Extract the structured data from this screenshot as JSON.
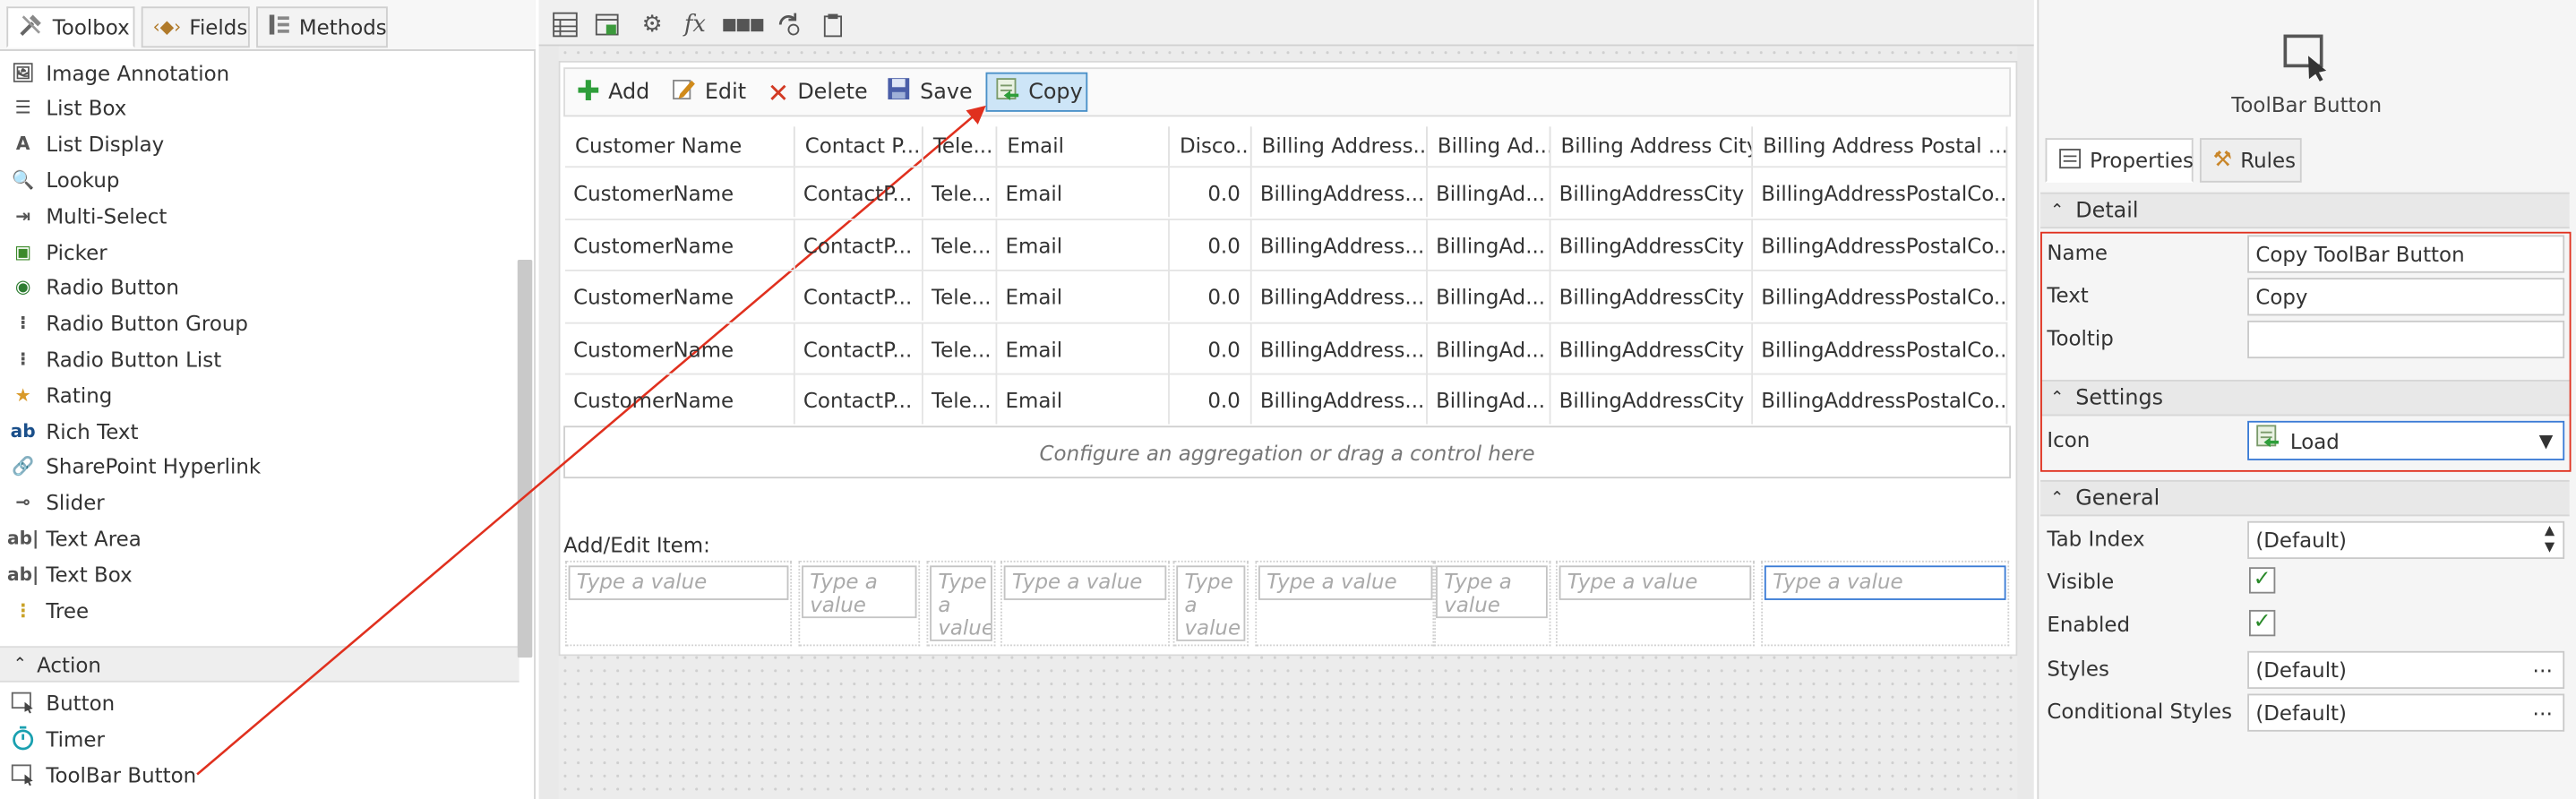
{
  "toolbox": {
    "tabs": [
      {
        "label": "Toolbox"
      },
      {
        "label": "Fields"
      },
      {
        "label": "Methods"
      }
    ],
    "items": [
      {
        "label": "Image Annotation",
        "icon": "image-annotation-icon"
      },
      {
        "label": "List Box",
        "icon": "list-box-icon"
      },
      {
        "label": "List Display",
        "icon": "list-display-icon"
      },
      {
        "label": "Lookup",
        "icon": "lookup-icon"
      },
      {
        "label": "Multi-Select",
        "icon": "multi-select-icon"
      },
      {
        "label": "Picker",
        "icon": "picker-icon"
      },
      {
        "label": "Radio Button",
        "icon": "radio-button-icon"
      },
      {
        "label": "Radio Button Group",
        "icon": "radio-button-group-icon"
      },
      {
        "label": "Radio Button List",
        "icon": "radio-button-list-icon"
      },
      {
        "label": "Rating",
        "icon": "rating-icon"
      },
      {
        "label": "Rich Text",
        "icon": "rich-text-icon"
      },
      {
        "label": "SharePoint Hyperlink",
        "icon": "hyperlink-icon"
      },
      {
        "label": "Slider",
        "icon": "slider-icon"
      },
      {
        "label": "Text Area",
        "icon": "text-area-icon"
      },
      {
        "label": "Text Box",
        "icon": "text-box-icon"
      },
      {
        "label": "Tree",
        "icon": "tree-icon"
      }
    ],
    "action_section": "Action",
    "action_items": [
      {
        "label": "Button",
        "icon": "button-icon"
      },
      {
        "label": "Timer",
        "icon": "timer-icon"
      },
      {
        "label": "ToolBar Button",
        "icon": "toolbar-button-icon"
      }
    ]
  },
  "designer": {
    "toolbar_buttons": [
      {
        "label": "Add",
        "icon": "plus-icon",
        "color": "#2e9e3a"
      },
      {
        "label": "Edit",
        "icon": "edit-icon",
        "color": "#d08a1a"
      },
      {
        "label": "Delete",
        "icon": "delete-icon",
        "color": "#d23a24"
      },
      {
        "label": "Save",
        "icon": "save-icon",
        "color": "#4a5ea8"
      },
      {
        "label": "Copy",
        "icon": "copy-icon",
        "color": "#3a8ad0"
      }
    ],
    "columns": [
      "Customer Name",
      "Contact P...",
      "Tele...",
      "Email",
      "Disco...",
      "Billing Address...",
      "Billing Ad...",
      "Billing Address City",
      "Billing Address Postal ..."
    ],
    "rows": [
      [
        "CustomerName",
        "ContactP...",
        "Tele...",
        "Email",
        "0.0",
        "BillingAddress...",
        "BillingAd...",
        "BillingAddressCity",
        "BillingAddressPostalCo..."
      ],
      [
        "CustomerName",
        "ContactP...",
        "Tele...",
        "Email",
        "0.0",
        "BillingAddress...",
        "BillingAd...",
        "BillingAddressCity",
        "BillingAddressPostalCo..."
      ],
      [
        "CustomerName",
        "ContactP...",
        "Tele...",
        "Email",
        "0.0",
        "BillingAddress...",
        "BillingAd...",
        "BillingAddressCity",
        "BillingAddressPostalCo..."
      ],
      [
        "CustomerName",
        "ContactP...",
        "Tele...",
        "Email",
        "0.0",
        "BillingAddress...",
        "BillingAd...",
        "BillingAddressCity",
        "BillingAddressPostalCo..."
      ],
      [
        "CustomerName",
        "ContactP...",
        "Tele...",
        "Email",
        "0.0",
        "BillingAddress...",
        "BillingAd...",
        "BillingAddressCity",
        "BillingAddressPostalCo..."
      ]
    ],
    "aggregation_hint": "Configure an aggregation or drag a control here",
    "add_edit_label": "Add/Edit Item:",
    "input_placeholder": "Type a value"
  },
  "properties": {
    "control_title": "ToolBar Button",
    "tabs": [
      {
        "label": "Properties"
      },
      {
        "label": "Rules"
      }
    ],
    "detail_section": "Detail",
    "name_label": "Name",
    "name_value": "Copy ToolBar Button",
    "text_label": "Text",
    "text_value": "Copy",
    "tooltip_label": "Tooltip",
    "tooltip_value": "",
    "settings_section": "Settings",
    "icon_label": "Icon",
    "icon_value": "Load",
    "general_section": "General",
    "tab_index_label": "Tab Index",
    "tab_index_value": "(Default)",
    "visible_label": "Visible",
    "visible_checked": true,
    "enabled_label": "Enabled",
    "enabled_checked": true,
    "styles_label": "Styles",
    "styles_value": "(Default)",
    "conditional_styles_label": "Conditional Styles",
    "conditional_styles_value": "(Default)"
  },
  "colors": {
    "highlight_border": "#e0301e",
    "arrow": "#e0301e",
    "selected_button": "#cde5f7"
  }
}
